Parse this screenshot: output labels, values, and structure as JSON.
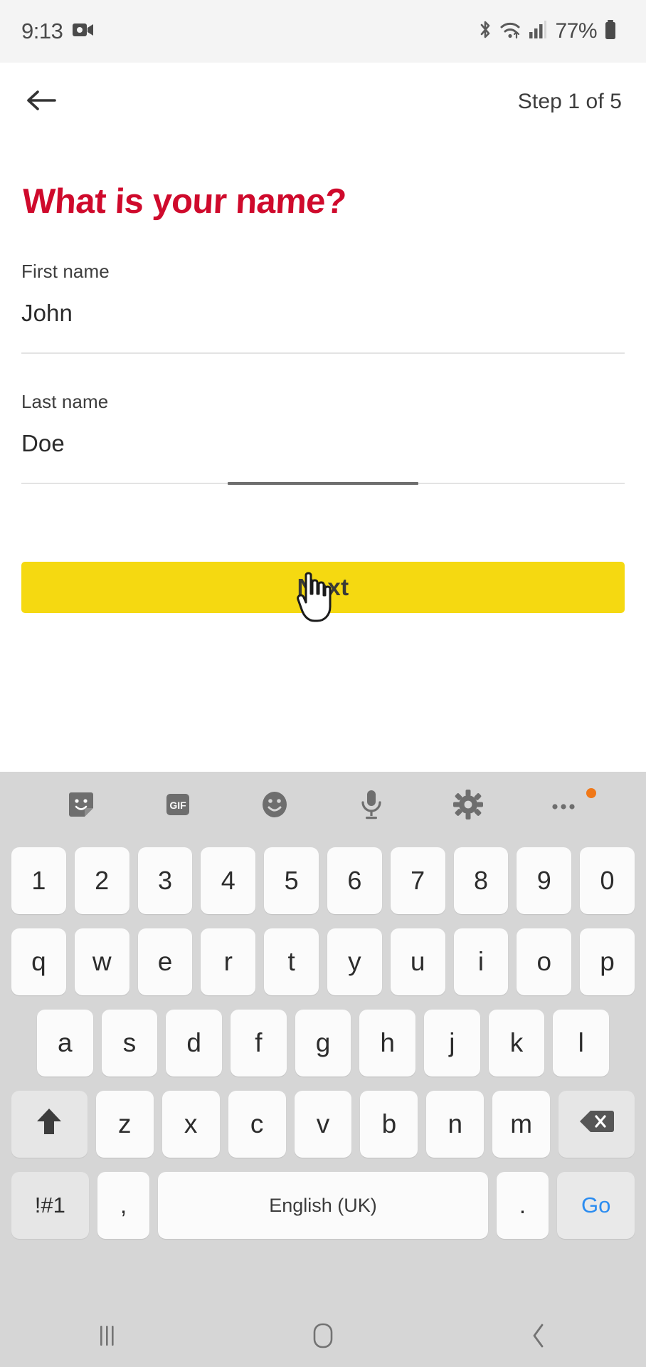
{
  "status_bar": {
    "time": "9:13",
    "battery_percent": "77%",
    "icons": [
      "video-recording-icon",
      "bluetooth-icon",
      "wifi-icon",
      "cellular-signal-icon",
      "battery-icon"
    ]
  },
  "header": {
    "back_icon": "arrow-left-icon",
    "step_text": "Step 1 of 5"
  },
  "content": {
    "heading": "What is your name?",
    "fields": [
      {
        "label": "First name",
        "value": "John",
        "placeholder": "First name",
        "focused": false
      },
      {
        "label": "Last name",
        "value": "Doe",
        "placeholder": "Last name",
        "focused": true
      }
    ],
    "primary_button": "Next"
  },
  "colors": {
    "brand_red": "#cf0a2c",
    "accent_yellow": "#f5d911",
    "keyboard_bg": "#d6d6d6",
    "go_key_blue": "#2b8cf0",
    "badge_orange": "#f07818"
  },
  "keyboard": {
    "toolbar": [
      {
        "name": "sticker-icon",
        "label": ""
      },
      {
        "name": "gif-icon",
        "label": "GIF"
      },
      {
        "name": "emoji-icon",
        "label": ""
      },
      {
        "name": "microphone-icon",
        "label": ""
      },
      {
        "name": "gear-icon",
        "label": ""
      },
      {
        "name": "more-options-icon",
        "label": ""
      }
    ],
    "row_numbers": [
      "1",
      "2",
      "3",
      "4",
      "5",
      "6",
      "7",
      "8",
      "9",
      "0"
    ],
    "row_qwerty": [
      "q",
      "w",
      "e",
      "r",
      "t",
      "y",
      "u",
      "i",
      "o",
      "p"
    ],
    "row_asdf": [
      "a",
      "s",
      "d",
      "f",
      "g",
      "h",
      "j",
      "k",
      "l"
    ],
    "row_zxcv": [
      "z",
      "x",
      "c",
      "v",
      "b",
      "n",
      "m"
    ],
    "shift_key": "shift-icon",
    "backspace_key": "backspace-icon",
    "symbols_key": "!#1",
    "comma_key": ",",
    "space_key": "English (UK)",
    "period_key": ".",
    "go_key": "Go"
  },
  "nav_bar": {
    "recents": "recents-icon",
    "home": "home-icon",
    "back": "back-icon"
  }
}
